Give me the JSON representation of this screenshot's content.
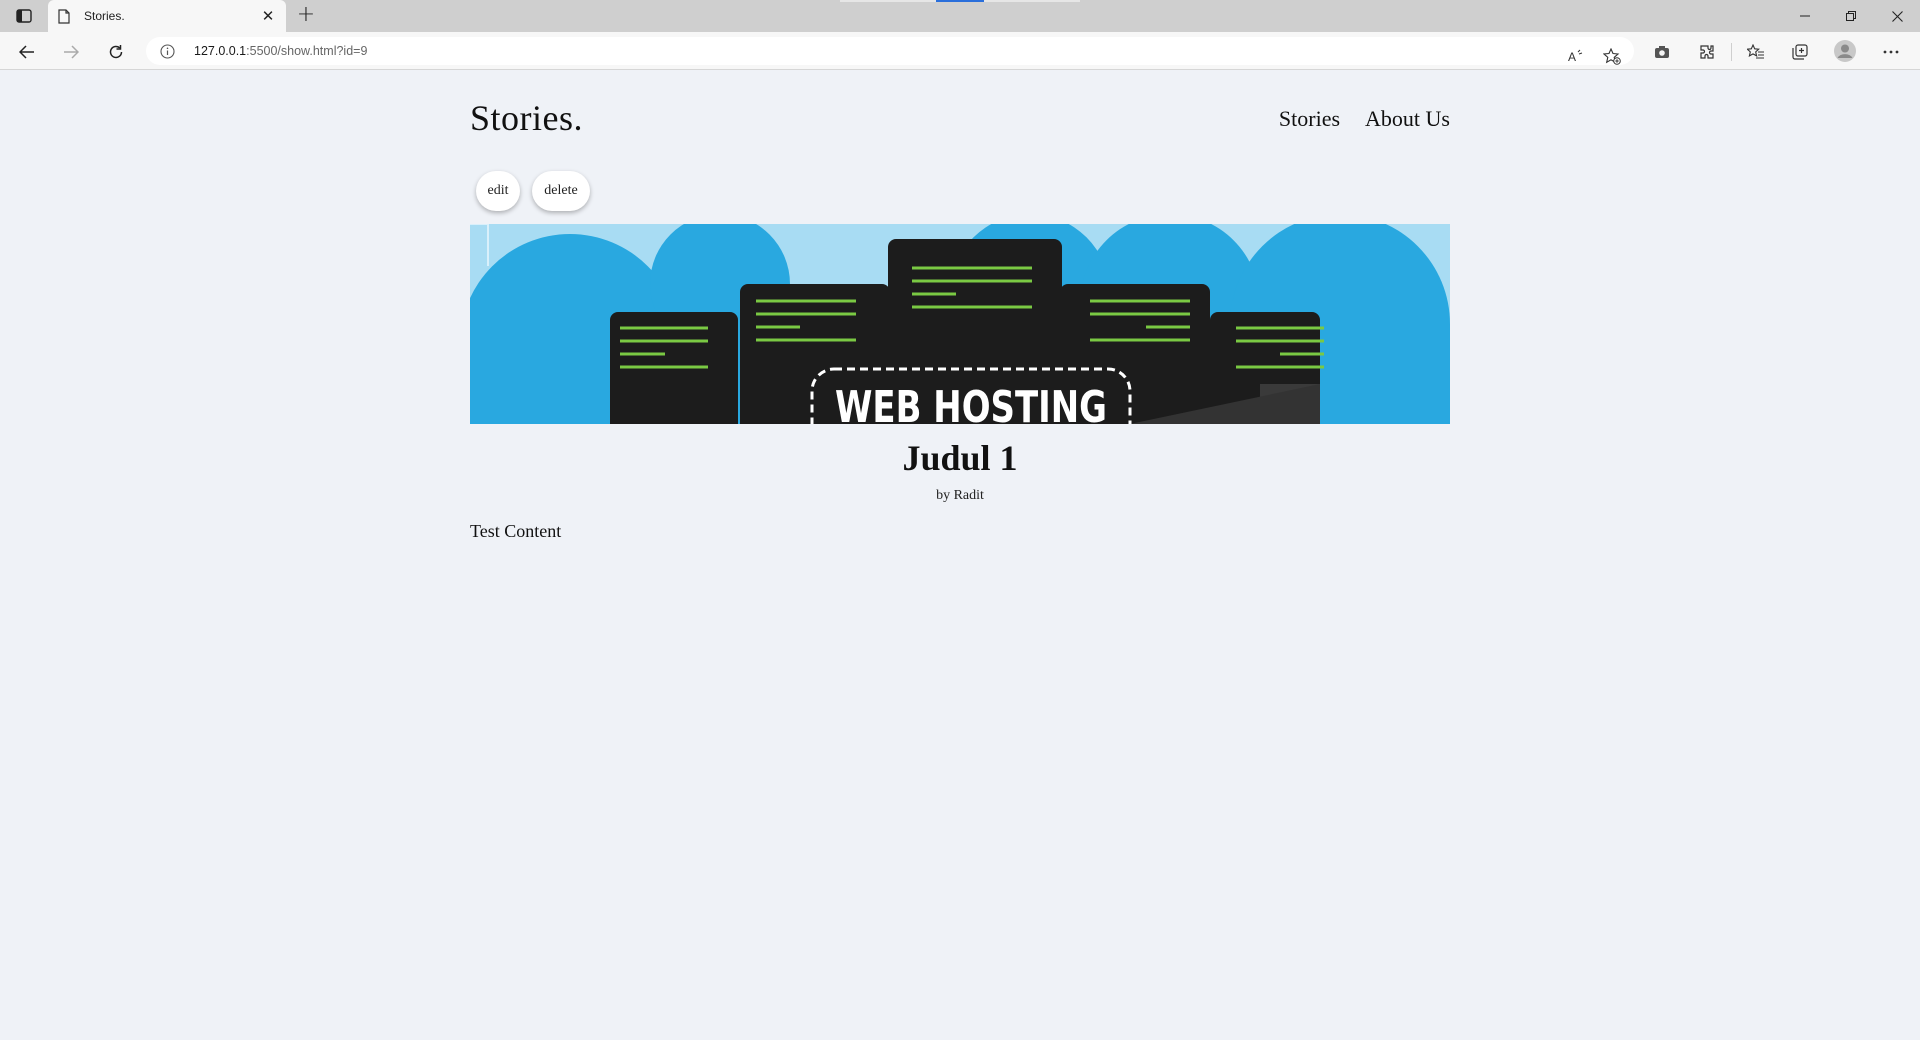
{
  "browser": {
    "tab_title": "Stories.",
    "url_host": "127.0.0.1",
    "url_rest": ":5500/show.html?id=9"
  },
  "site": {
    "brand": "Stories.",
    "nav": [
      "Stories",
      "About Us"
    ]
  },
  "story": {
    "edit_label": "edit",
    "delete_label": "delete",
    "image_text": "WEB HOSTING",
    "title": "Judul 1",
    "byline": "by Radit",
    "content": "Test Content"
  },
  "colors": {
    "page_bg": "#eff2f7",
    "sky": "#29a8e0",
    "server": "#1c1c1c",
    "led": "#7ac943"
  }
}
